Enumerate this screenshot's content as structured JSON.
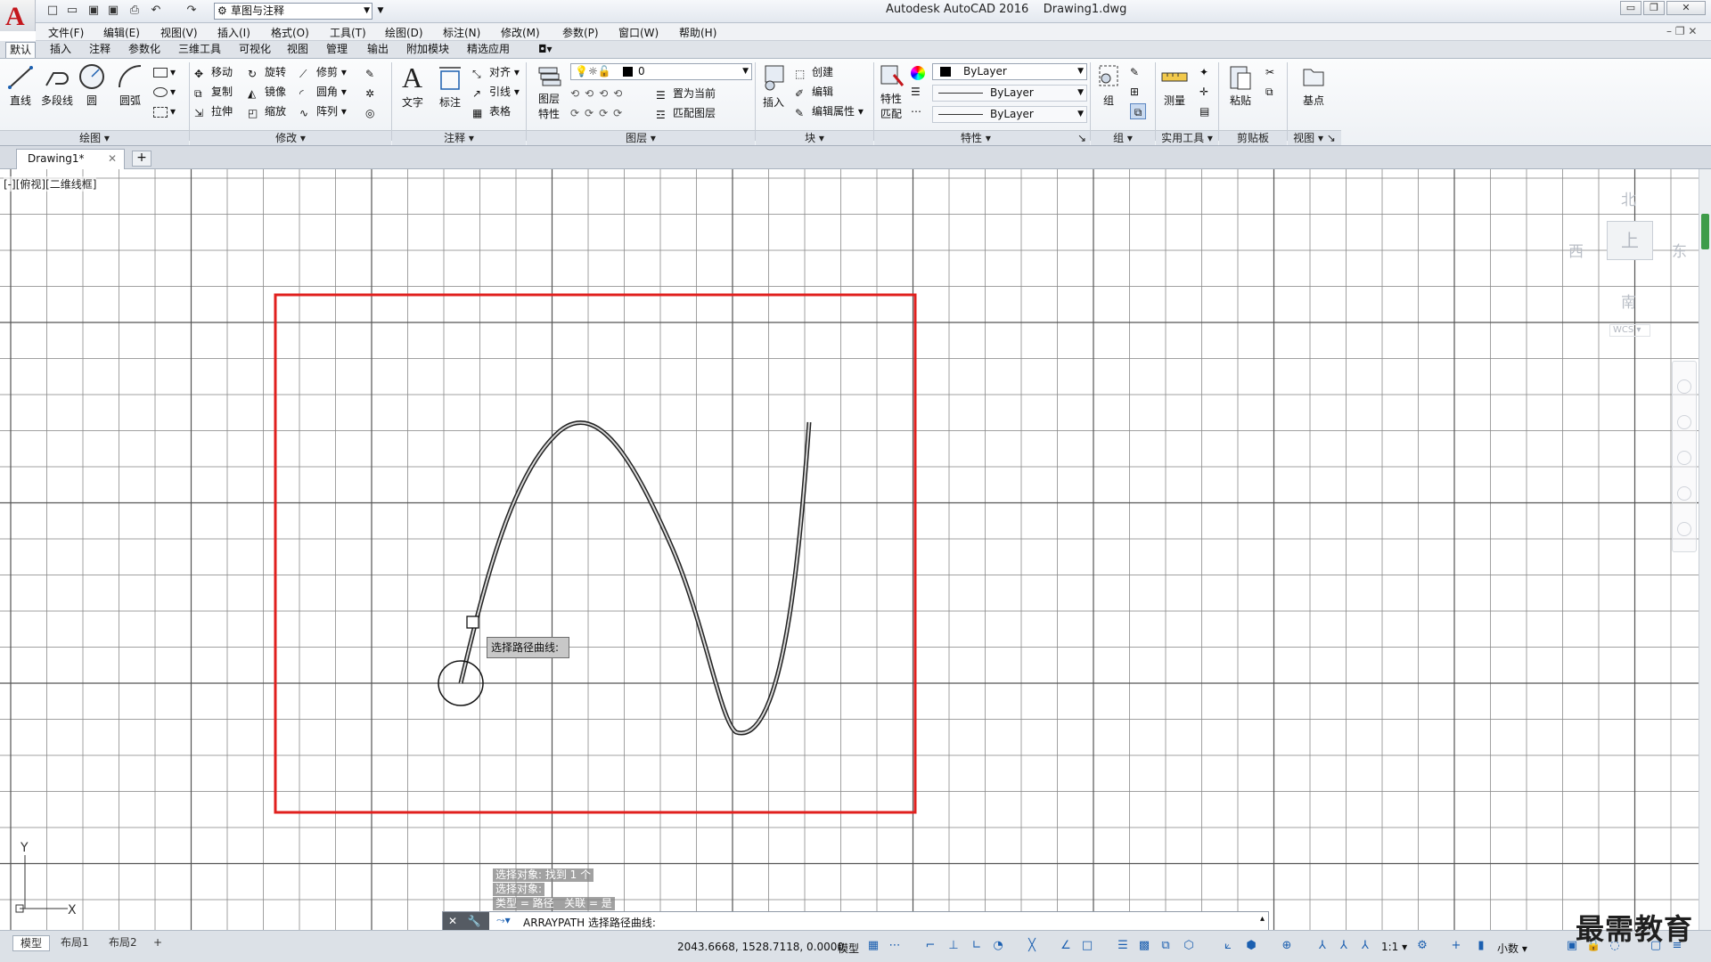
{
  "title_bar": {
    "app_name": "Autodesk AutoCAD 2016",
    "file_name": "Drawing1.dwg",
    "workspace": "草图与注释"
  },
  "menu": [
    "文件(F)",
    "编辑(E)",
    "视图(V)",
    "插入(I)",
    "格式(O)",
    "工具(T)",
    "绘图(D)",
    "标注(N)",
    "修改(M)",
    "参数(P)",
    "窗口(W)",
    "帮助(H)"
  ],
  "ribbon_tabs": [
    "默认",
    "插入",
    "注释",
    "参数化",
    "三维工具",
    "可视化",
    "视图",
    "管理",
    "输出",
    "附加模块",
    "精选应用"
  ],
  "ribbon": {
    "draw": {
      "line": "直线",
      "polyline": "多段线",
      "circle": "圆",
      "arc": "圆弧",
      "panel": "绘图"
    },
    "modify": {
      "move": "移动",
      "rotate": "旋转",
      "trim": "修剪",
      "copy": "复制",
      "mirror": "镜像",
      "fillet": "圆角",
      "stretch": "拉伸",
      "scale": "缩放",
      "array": "阵列",
      "panel": "修改"
    },
    "annotation": {
      "text": "文字",
      "dimension": "标注",
      "align": "对齐",
      "leader": "引线",
      "table": "表格",
      "panel": "注释"
    },
    "layers": {
      "layer_props": "图层",
      "layer_props2": "特性",
      "current_layer": "0",
      "set_current": "置为当前",
      "match_layer": "匹配图层",
      "panel": "图层"
    },
    "block": {
      "insert": "插入",
      "create": "创建",
      "edit": "编辑",
      "edit_attr": "编辑属性",
      "panel": "块"
    },
    "properties": {
      "match": "特性",
      "match2": "匹配",
      "color": "ByLayer",
      "linetype": "ByLayer",
      "lineweight": "ByLayer",
      "panel": "特性"
    },
    "groups": {
      "group": "组",
      "panel": "组"
    },
    "utilities": {
      "measure": "测量",
      "panel": "实用工具"
    },
    "clipboard": {
      "paste": "粘贴",
      "panel": "剪贴板"
    },
    "view": {
      "base": "基点",
      "panel": "视图"
    }
  },
  "doc_tab": "Drawing1*",
  "viewport_label": "[-][俯视][二维线框]",
  "viewcube": {
    "north": "北",
    "south": "南",
    "east": "东",
    "west": "西",
    "face": "上",
    "wcs": "WCS"
  },
  "tooltip": "选择路径曲线:",
  "command_history": [
    "选择对象: 找到 1 个",
    "选择对象:",
    "类型 = 路径   关联 = 是"
  ],
  "command_line": "ARRAYPATH 选择路径曲线:",
  "layout_tabs": [
    "模型",
    "布局1",
    "布局2"
  ],
  "status": {
    "coords": "2043.6668, 1528.7118, 0.0000",
    "model": "模型",
    "scale": "1:1",
    "units": "小数"
  },
  "watermark": "最需教育",
  "colors": {
    "accent_red": "#e0201e",
    "grid": "#8a8a8a"
  }
}
